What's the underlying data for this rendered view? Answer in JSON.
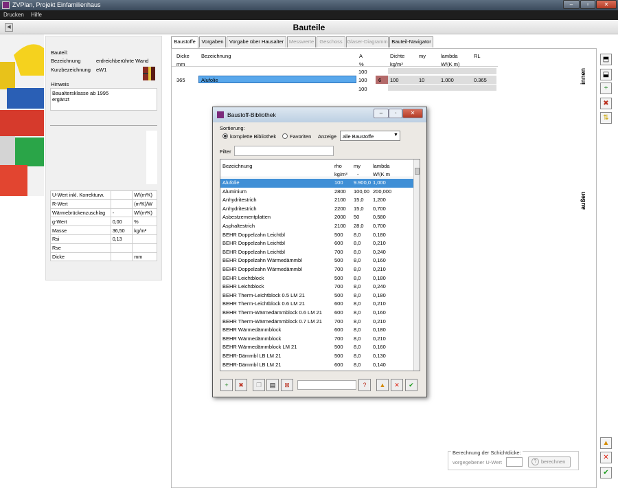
{
  "window": {
    "title": "ZVPlan, Projekt Einfamilienhaus"
  },
  "menu": [
    "Drucken",
    "Hilfe"
  ],
  "page": {
    "title": "Bauteile",
    "back_icon": "left-arrow-icon"
  },
  "bauteil": {
    "heading": "Bauteil:",
    "bez_label": "Bezeichnung",
    "bez_value": "erdreichberührte Wand",
    "kurz_label": "Kurzbezeichnung",
    "kurz_value": "eW1",
    "hinweis_label": "Hinweis",
    "hinweis_line1": "Baualtersklasse ab 1995",
    "hinweis_line2": "ergänzt"
  },
  "properties": [
    {
      "label": "U-Wert inkl. Korrekturw.",
      "value": "",
      "unit": "W/(m²K)"
    },
    {
      "label": "R-Wert",
      "value": "",
      "unit": "(m²K)/W"
    },
    {
      "label": "Wärmebrückenzuschlag",
      "value": "-",
      "unit": "W/(m²K)"
    },
    {
      "label": "g-Wert",
      "value": "0,00",
      "unit": "%"
    },
    {
      "label": "Masse",
      "value": "36,50",
      "unit": "kg/m²"
    },
    {
      "label": "Rsi",
      "value": "0,13",
      "unit": ""
    },
    {
      "label": "Rse",
      "value": "",
      "unit": ""
    },
    {
      "label": "Dicke",
      "value": "",
      "unit": "mm"
    }
  ],
  "tabs": [
    {
      "label": "Baustoffe",
      "state": "active"
    },
    {
      "label": "Vorgaben",
      "state": "normal"
    },
    {
      "label": "Vorgabe über Hausalter",
      "state": "normal"
    },
    {
      "label": "Messwerte",
      "state": "disabled"
    },
    {
      "label": "Geschoss",
      "state": "disabled"
    },
    {
      "label": "Glaser-Diagramm",
      "state": "disabled"
    },
    {
      "label": "Bauteil-Navigator",
      "state": "normal"
    }
  ],
  "grid": {
    "headers": {
      "dicke": "Dicke",
      "bez": "Bezeichnung",
      "a": "A",
      "dichte": "Dichte",
      "my": "my",
      "lambda": "lambda",
      "rl": "RL"
    },
    "units": {
      "dicke": "mm",
      "a": "%",
      "dichte": "kg/m³",
      "lambda": "W/(K m)"
    },
    "row_a_top": "100",
    "row_a_bottom": "100",
    "layer": {
      "dicke": "365",
      "bez": "Alufolie",
      "a": "100",
      "num": "6",
      "dichte": "100",
      "my": "10",
      "lambda": "1.000",
      "rl": "0.365"
    },
    "side_innen": "innen",
    "side_aussen": "außen"
  },
  "calc": {
    "title": "Berechnung der Schichtdicke:",
    "label": "vorgegebener U-Wert",
    "value": "",
    "button": "berechnen"
  },
  "dialog": {
    "title": "Baustoff-Bibliothek",
    "sort_label": "Sortierung:",
    "opt_full": "komplette Bibliothek",
    "opt_fav": "Favoriten",
    "anzeige_label": "Anzeige",
    "anzeige_value": "alle Baustoffe",
    "filter_label": "Filter",
    "filter_value": "",
    "search_value": "",
    "columns": {
      "bez": "Bezeichnung",
      "rho": "rho",
      "my": "my",
      "lambda": "lambda"
    },
    "units": {
      "rho": "kg/m³",
      "my": "-",
      "lambda": "W/(K m"
    },
    "rows": [
      {
        "bez": "Alufolie",
        "rho": "100",
        "my": "9.900,0",
        "lambda": "1,000"
      },
      {
        "bez": "Aluminium",
        "rho": "2800",
        "my": "100,00",
        "lambda": "200,000"
      },
      {
        "bez": "Anhydritestrich",
        "rho": "2100",
        "my": "15,0",
        "lambda": "1,200"
      },
      {
        "bez": "Anhydritestrich",
        "rho": "2200",
        "my": "15,0",
        "lambda": "0,700"
      },
      {
        "bez": "Asbestzementplatten",
        "rho": "2000",
        "my": "50",
        "lambda": "0,580"
      },
      {
        "bez": "Asphaltestrich",
        "rho": "2100",
        "my": "28,0",
        "lambda": "0,700"
      },
      {
        "bez": "BEHR Doppelzahn Leichtbl",
        "rho": "500",
        "my": "8,0",
        "lambda": "0,180"
      },
      {
        "bez": "BEHR Doppelzahn Leichtbl",
        "rho": "600",
        "my": "8,0",
        "lambda": "0,210"
      },
      {
        "bez": "BEHR Doppelzahn Leichtbl",
        "rho": "700",
        "my": "8,0",
        "lambda": "0,240"
      },
      {
        "bez": "BEHR Doppelzahn Wärmedämmbl",
        "rho": "500",
        "my": "8,0",
        "lambda": "0,160"
      },
      {
        "bez": "BEHR Doppelzahn Wärmedämmbl",
        "rho": "700",
        "my": "8,0",
        "lambda": "0,210"
      },
      {
        "bez": "BEHR Leichtblock",
        "rho": "500",
        "my": "8,0",
        "lambda": "0,180"
      },
      {
        "bez": "BEHR Leichtblock",
        "rho": "700",
        "my": "8,0",
        "lambda": "0,240"
      },
      {
        "bez": "BEHR Therm-Leichtblock 0.5 LM 21",
        "rho": "500",
        "my": "8,0",
        "lambda": "0,180"
      },
      {
        "bez": "BEHR Therm-Leichtblock 0.6 LM 21",
        "rho": "600",
        "my": "8,0",
        "lambda": "0,210"
      },
      {
        "bez": "BEHR Therm-Wärmedämmblock 0.6 LM 21",
        "rho": "600",
        "my": "8,0",
        "lambda": "0,160"
      },
      {
        "bez": "BEHR Therm-Wärmedämmblock 0.7 LM 21",
        "rho": "700",
        "my": "8,0",
        "lambda": "0,210"
      },
      {
        "bez": "BEHR Wärmedämmblock",
        "rho": "600",
        "my": "8,0",
        "lambda": "0,180"
      },
      {
        "bez": "BEHR Wärmedämmblock",
        "rho": "700",
        "my": "8,0",
        "lambda": "0,210"
      },
      {
        "bez": "BEHR Wärmedämmblock LM 21",
        "rho": "500",
        "my": "8,0",
        "lambda": "0,160"
      },
      {
        "bez": "BEHR-Dämmbl LB LM 21",
        "rho": "500",
        "my": "8,0",
        "lambda": "0,130"
      },
      {
        "bez": "BEHR-Dämmbl LB LM 21",
        "rho": "600",
        "my": "8,0",
        "lambda": "0,140"
      }
    ]
  }
}
